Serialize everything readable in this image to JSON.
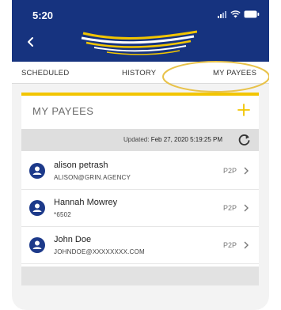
{
  "status_bar": {
    "time": "5:20"
  },
  "tabs": [
    {
      "label": "SCHEDULED"
    },
    {
      "label": "HISTORY"
    },
    {
      "label": "MY PAYEES"
    }
  ],
  "active_tab": "MY PAYEES",
  "card": {
    "title": "MY PAYEES",
    "updated_prefix": "Updated: ",
    "updated_value": "Feb 27, 2020 5:19:25 PM"
  },
  "payees": [
    {
      "name": "alison petrash",
      "detail": "ALISON@GRIN.AGENCY",
      "type": "P2P"
    },
    {
      "name": "Hannah Mowrey",
      "detail": "*6502",
      "type": "P2P"
    },
    {
      "name": "John Doe",
      "detail": "JOHNDOE@XXXXXXXX.COM",
      "type": "P2P"
    }
  ],
  "colors": {
    "header_bg": "#16337f",
    "accent_yellow": "#f2c500",
    "avatar_blue": "#1d3a8a"
  },
  "icons": {
    "back": "chevron-left-icon",
    "add": "plus-icon",
    "refresh": "refresh-icon",
    "avatar": "person-icon",
    "row_arrow": "chevron-right-icon"
  }
}
